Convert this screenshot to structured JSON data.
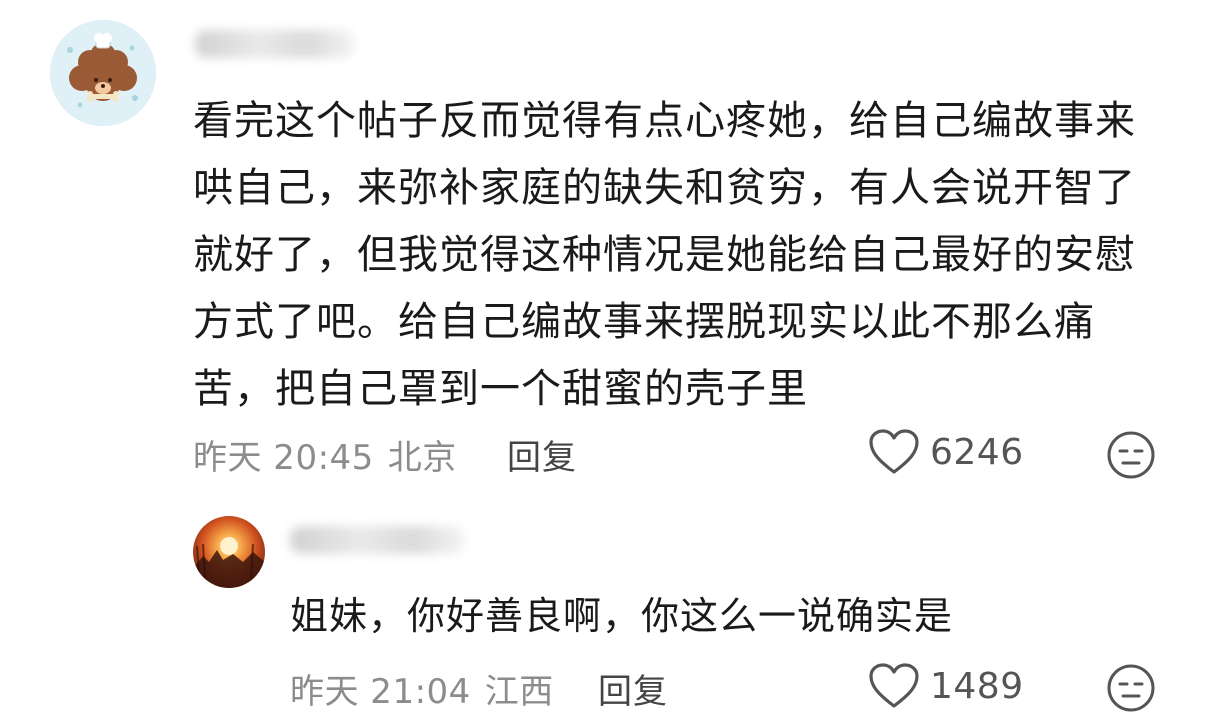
{
  "comment": {
    "avatar_icon": "poodle-avatar-icon",
    "text": "看完这个帖子反而觉得有点心疼她，给自己编故事来哄自己，来弥补家庭的缺失和贫穷，有人会说开智了就好了，但我觉得这种情况是她能给自己最好的安慰方式了吧。给自己编故事来摆脱现实以此不那么痛苦，把自己罩到一个甜蜜的壳子里",
    "time": "昨天 20:45",
    "location": "北京",
    "reply_label": "回复",
    "like_count": "6246"
  },
  "reply": {
    "avatar_icon": "sunset-avatar-icon",
    "text": "姐妹，你好善良啊，你这么一说确实是",
    "time": "昨天 21:04",
    "location": "江西",
    "reply_label": "回复",
    "like_count": "1489"
  },
  "colors": {
    "text": "#1a1a1a",
    "meta": "#8c8c8c",
    "icon": "#555555"
  }
}
